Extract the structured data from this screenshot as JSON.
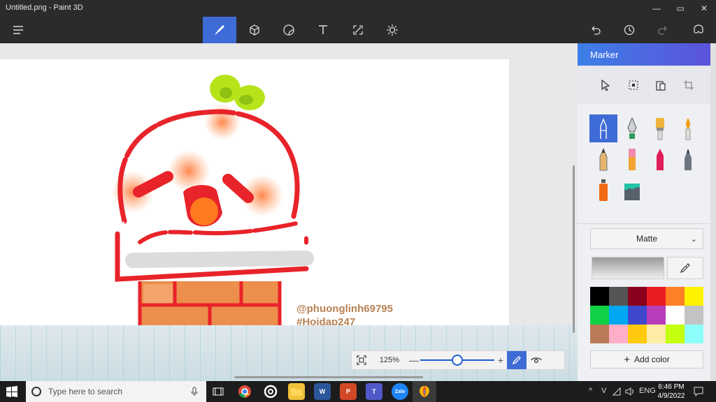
{
  "window": {
    "title": "Untitled.png - Paint 3D",
    "minimize_glyph": "—",
    "maximize_glyph": "▭",
    "close_glyph": "✕"
  },
  "toolbar": {
    "tools": [
      {
        "name": "menu-icon"
      },
      {
        "name": "brushes-icon",
        "active": true
      },
      {
        "name": "3d-shapes-icon"
      },
      {
        "name": "stickers-icon"
      },
      {
        "name": "text-icon"
      },
      {
        "name": "canvas-icon"
      },
      {
        "name": "effects-icon"
      },
      {
        "name": "undo-icon"
      },
      {
        "name": "history-icon"
      },
      {
        "name": "redo-icon"
      },
      {
        "name": "mixed-reality-icon"
      }
    ]
  },
  "canvas": {
    "watermark_line1": "@phuonglinh69795",
    "watermark_line2": "#Hoidap247"
  },
  "zoom": {
    "percent": "125%",
    "minus": "—",
    "plus": "+",
    "level_fraction": 0.5
  },
  "panel": {
    "title": "Marker",
    "select_tools": [
      "select-icon",
      "crop-select-icon",
      "paste-icon",
      "crop-icon"
    ],
    "brushes": [
      "marker",
      "calligraphy-pen",
      "oil-brush",
      "watercolor",
      "pencil",
      "eraser",
      "crayon",
      "pixel-pen",
      "spray-can",
      "fill"
    ],
    "active_brush": "marker",
    "finish": "Matte",
    "palette": [
      "#000000",
      "#555555",
      "#88001b",
      "#ec1c24",
      "#ff7f27",
      "#fff200",
      "#0ed145",
      "#00a8f3",
      "#3f48cc",
      "#b83dba",
      "#ffffff",
      "#c3c3c3",
      "#b97a57",
      "#ffaec8",
      "#ffc90e",
      "#fdeca6",
      "#c4ff0e",
      "#8cfffb"
    ],
    "add_color_label": "Add color",
    "add_color_glyph": "+"
  },
  "taskbar": {
    "search_placeholder": "Type here to search",
    "apps": [
      "task-view",
      "chrome",
      "cortana-ring",
      "file-explorer",
      "word",
      "powerpoint",
      "teams",
      "zalo",
      "paint3d"
    ],
    "tray": {
      "chevron": "^",
      "v": "V",
      "lang": "ENG"
    },
    "time": "6:46 PM",
    "date": "4/9/2022"
  }
}
